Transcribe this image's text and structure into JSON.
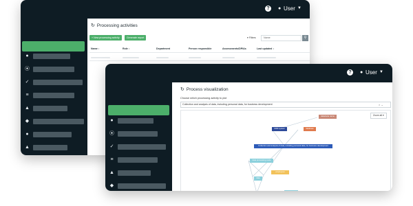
{
  "back_window": {
    "header": {
      "user_label": "User"
    },
    "sidebar": {
      "icons": [
        "head-icon",
        "compass-icon",
        "check-icon",
        "list-icon",
        "grad-cap-icon",
        "shield-icon",
        "people-icon",
        "warning-icon"
      ]
    },
    "content": {
      "title": "Processing activities",
      "new_button": "+ New processing activity",
      "report_button": "Generate report",
      "filters_label": "Filters",
      "search_value": "Name",
      "columns": [
        "Name",
        "Role",
        "Department",
        "Person responsible",
        "Assessments/DPIAs",
        "Last updated"
      ]
    }
  },
  "front_window": {
    "header": {
      "user_label": "User"
    },
    "sidebar": {
      "icons": [
        "head-icon",
        "compass-icon",
        "check-icon",
        "list-icon",
        "grad-cap-icon",
        "shield-icon"
      ]
    },
    "content": {
      "title": "Process visualization",
      "prompt": "Choose which processing activity to plot",
      "selected": "Collection and analysis of data, including personal data, for business development",
      "zoom_label": "Zoom all",
      "nodes": {
        "top_right": "data/suite name",
        "crm": "CRM system",
        "red": "database",
        "main": "Collection and analysis of data, including personal data, for business development",
        "light_left": "data processing node",
        "yellow": "employees",
        "small_left": "data",
        "bottom": "source"
      }
    },
    "colors": {
      "main_node": "#2d5bb8",
      "crm_node": "#2d4a9a",
      "red_node": "#e07a4d",
      "rose_node": "#c98876",
      "light_node": "#8bd0dc",
      "yellow_node": "#f2c25a"
    }
  }
}
